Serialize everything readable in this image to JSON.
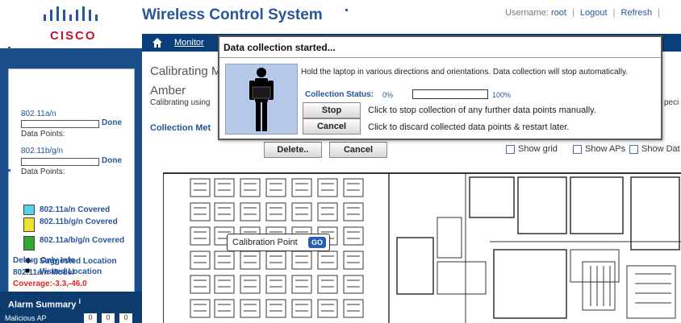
{
  "brand": {
    "logo_text": "CISCO",
    "app_title": "Wireless Control System"
  },
  "header": {
    "username_label": "Username:",
    "username": "root",
    "logout": "Logout",
    "refresh": "Refresh",
    "separator": "|"
  },
  "nav": {
    "monitor": "Monitor"
  },
  "sidebar": {
    "band1": {
      "label": "802.11a/n",
      "status": "Done",
      "points_label": "Data Points:"
    },
    "band2": {
      "label": "802.11b/g/n",
      "status": "Done",
      "points_label": "Data Points:"
    },
    "legend": [
      {
        "label": "802.11a/n Covered",
        "color": "#4fd6e8"
      },
      {
        "label": "802.11b/g/n Covered",
        "color": "#f0e22a"
      },
      {
        "label": "802.11a/b/g/n Covered",
        "color": "#2fa92f"
      }
    ],
    "suggested": "Suggested Location",
    "visited": "Visited Location",
    "debug": "Debug Only Info",
    "model": "802.11a/n Model",
    "coverage": "Coverage:-3.3,-46.0"
  },
  "alarm": {
    "title": "Alarm Summary",
    "info_glyph": "i",
    "row_label": "Malicious AP",
    "counts": [
      "0",
      "0",
      "0"
    ]
  },
  "main": {
    "title": "Calibrating M",
    "floor": "Amber",
    "description": "Calibrating using",
    "collection_label": "Collection Met",
    "spec_text": "peci",
    "delete_button": "Delete..",
    "cancel_button": "Cancel",
    "show_grid": "Show grid",
    "show_aps": "Show APs",
    "show_dat": "Show Dat"
  },
  "callout": {
    "label": "Calibration Point",
    "go": "GO"
  },
  "dialog": {
    "title": "Data collection started...",
    "message": "Hold the laptop in various directions and orientations. Data collection will stop automatically.",
    "status_label": "Collection Status:",
    "status_start": "0%",
    "status_end": "100%",
    "progress": 0,
    "stop_button": "Stop",
    "stop_help": "Click to stop collection of any further data points manually.",
    "cancel_button": "Cancel",
    "cancel_help": "Click to discard collected data points & restart later."
  }
}
